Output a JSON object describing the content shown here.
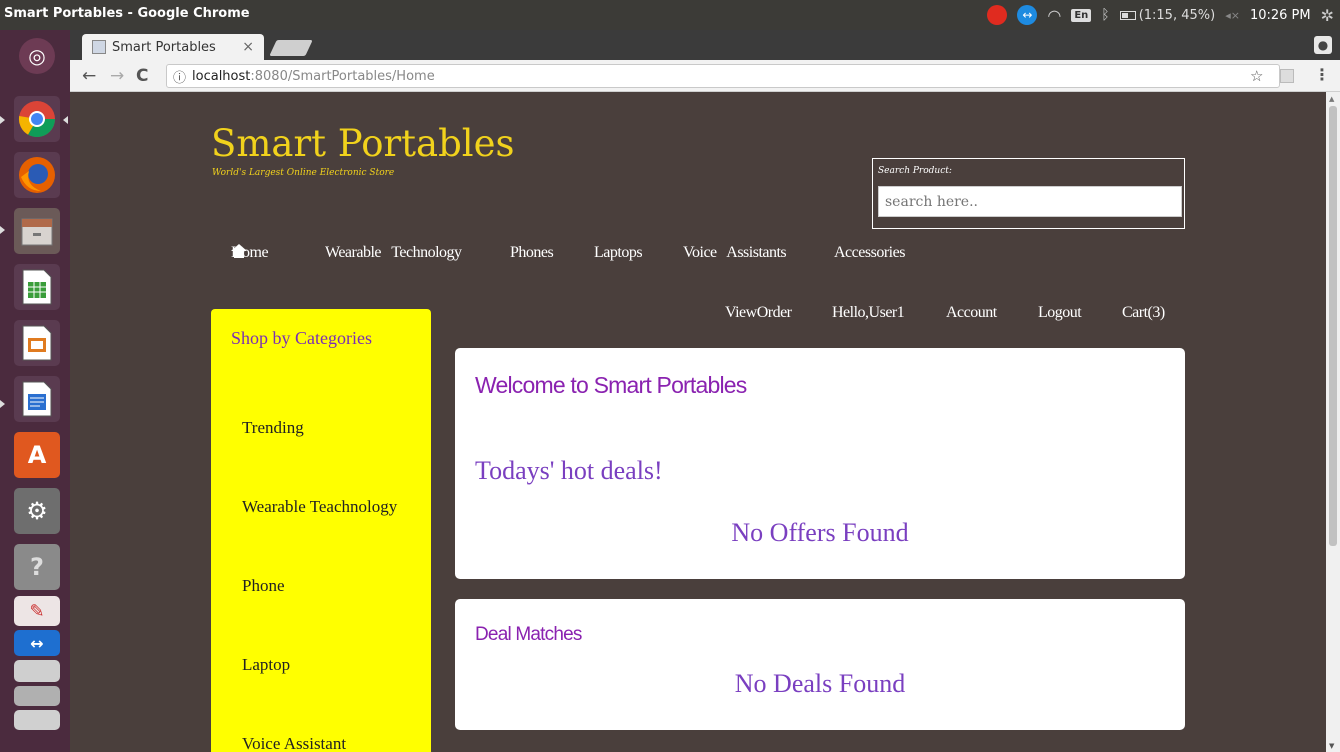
{
  "os_panel": {
    "window_title": "Smart Portables - Google Chrome",
    "keyboard": "En",
    "battery": "(1:15, 45%)",
    "time": "10:26 PM",
    "icons": [
      "record-icon",
      "teamviewer-icon",
      "wifi-icon",
      "keyboard-icon",
      "bluetooth-icon",
      "battery-icon",
      "volume-muted-icon",
      "settings-gear-icon"
    ]
  },
  "launcher": {
    "apps": [
      "ubuntu-dash",
      "chrome",
      "firefox",
      "files",
      "libreoffice-calc",
      "libreoffice-impress",
      "libreoffice-writer",
      "software-center",
      "system-settings",
      "help",
      "text-editor",
      "teamviewer",
      "scanner",
      "workspace-switcher",
      "trash"
    ]
  },
  "browser": {
    "tab_title": "Smart Portables",
    "tab_close": "×",
    "url_host": "localhost",
    "url_path": ":8080/SmartPortables/Home"
  },
  "header": {
    "site_title": "Smart Portables",
    "tagline": "World's Largest Online Electronic Store",
    "search_label": "Search Product:",
    "search_placeholder": "search here.."
  },
  "main_nav": {
    "items": [
      "Home",
      "Wearable   Technology",
      "Phones",
      "Laptops",
      "Voice   Assistants",
      "Accessories"
    ]
  },
  "user_nav": {
    "items": [
      "ViewOrder",
      "Hello,User1",
      "Account",
      "Logout",
      "Cart(3)"
    ]
  },
  "sidebar": {
    "title": "Shop by Categories",
    "items": [
      "Trending",
      "Wearable Teachnology",
      "Phone",
      "Laptop",
      "Voice Assistant"
    ]
  },
  "content": {
    "welcome": "Welcome to Smart Portables",
    "hot_deals": "Todays' hot deals!",
    "no_offers": "No Offers Found",
    "deal_matches": "Deal Matches",
    "no_deals": "No Deals Found"
  }
}
